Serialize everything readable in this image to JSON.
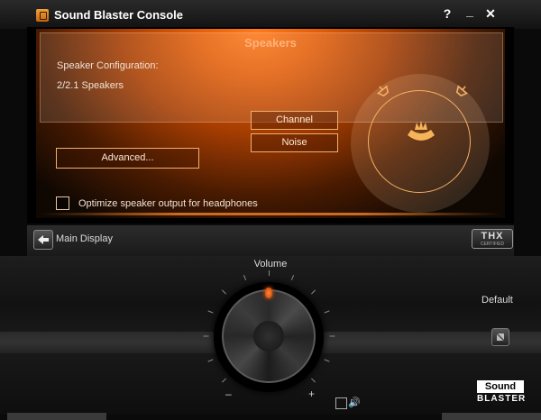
{
  "window": {
    "title": "Sound Blaster Console"
  },
  "titlebar": {
    "help": "?",
    "minimize": "_",
    "close": "✕"
  },
  "speakers_panel": {
    "heading": "Speakers",
    "config_label": "Speaker Configuration:",
    "config_value": "2/2.1 Speakers",
    "channel_button": "Channel",
    "noise_button": "Noise",
    "advanced_button": "Advanced...",
    "headphones_option": "Optimize speaker output for headphones",
    "headphones_checked": false
  },
  "nav": {
    "main_display": "Main Display",
    "thx_logo": "THX",
    "thx_sub": "CERTIFIED"
  },
  "volume": {
    "label": "Volume",
    "min_symbol": "–",
    "max_symbol": "+",
    "mute_icon": "🔊"
  },
  "default": {
    "label": "Default"
  },
  "brand": {
    "line1": "Sound",
    "line2": "BLASTER"
  },
  "colors": {
    "accent": "#ff7a1c",
    "panel_border": "#f0b070",
    "knob_indicator": "#ff5a00"
  }
}
